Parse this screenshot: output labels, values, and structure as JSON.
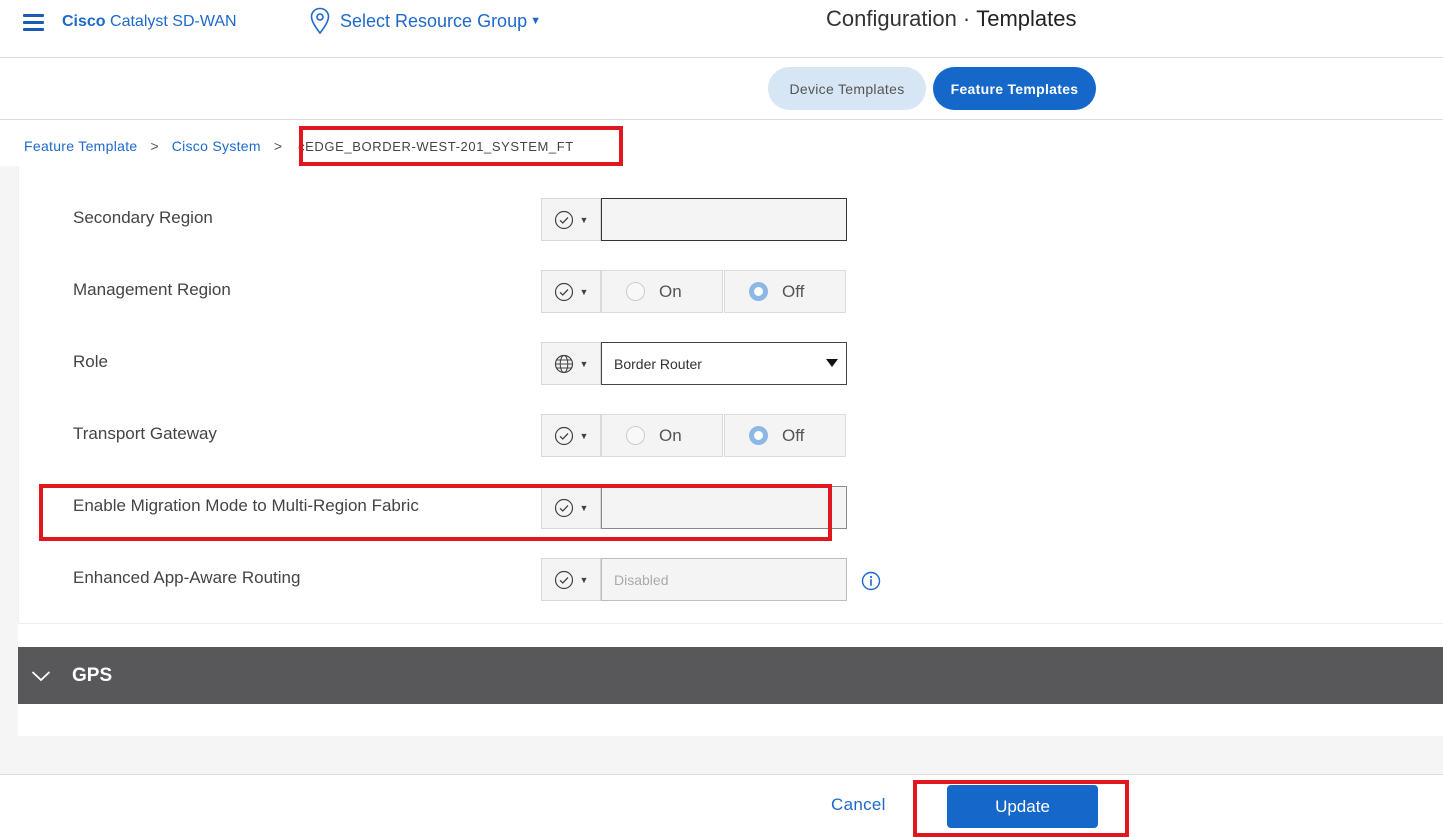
{
  "header": {
    "brand_bold": "Cisco",
    "brand_rest": "Catalyst SD-WAN",
    "resource_group": "Select Resource Group",
    "title_prefix": "Configuration",
    "title_separator": "·",
    "title_main": "Templates"
  },
  "tabs": [
    {
      "label": "Device Templates",
      "active": false
    },
    {
      "label": "Feature Templates",
      "active": true
    }
  ],
  "breadcrumb": {
    "items": [
      "Feature Template",
      "Cisco System"
    ],
    "current": "cEDGE_BORDER-WEST-201_SYSTEM_FT"
  },
  "form": {
    "rows": [
      {
        "label": "Secondary Region",
        "scope_icon": "check-circle-icon",
        "value": ""
      },
      {
        "label": "Management Region",
        "scope_icon": "check-circle-icon",
        "options": [
          "On",
          "Off"
        ],
        "selected": "Off"
      },
      {
        "label": "Role",
        "scope_icon": "globe-icon",
        "value": "Border Router"
      },
      {
        "label": "Transport Gateway",
        "scope_icon": "check-circle-icon",
        "options": [
          "On",
          "Off"
        ],
        "selected": "Off"
      },
      {
        "label": "Enable Migration Mode to Multi-Region Fabric",
        "scope_icon": "check-circle-icon",
        "value": ""
      },
      {
        "label": "Enhanced App-Aware Routing",
        "scope_icon": "check-circle-icon",
        "value": "Disabled"
      }
    ]
  },
  "sections": [
    {
      "label": "GPS",
      "icon": "chevron-down-icon"
    }
  ],
  "footer": {
    "cancel_label": "Cancel",
    "update_label": "Update"
  },
  "colors": {
    "accent": "#1568c9",
    "link": "#1d69cc",
    "highlight": "#e0171f",
    "section_bar": "#58585a"
  }
}
